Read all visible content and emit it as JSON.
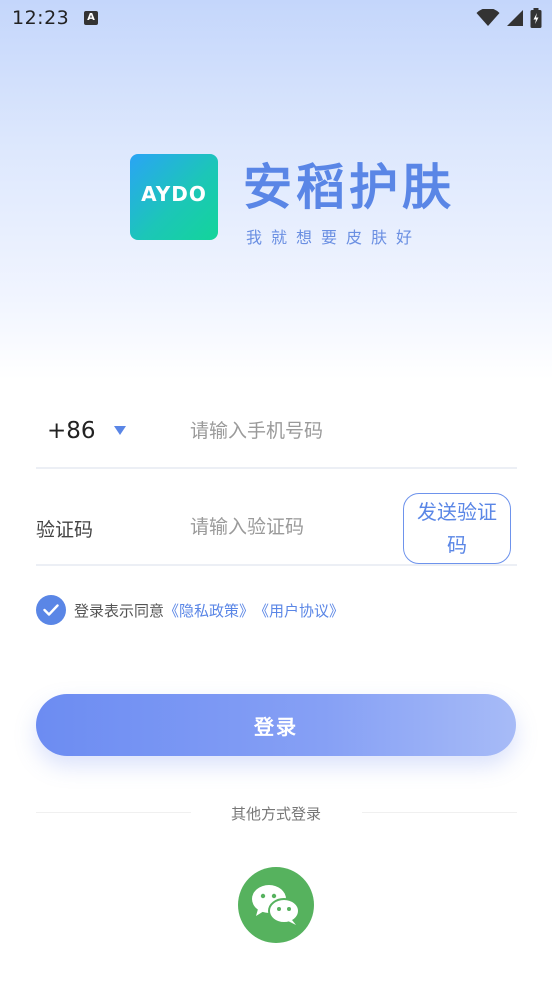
{
  "status_bar": {
    "time": "12:23",
    "notification_icon_label": "A",
    "icons": [
      "wifi-icon",
      "signal-icon",
      "battery-charging-icon"
    ]
  },
  "brand": {
    "logo_text": "AYDO",
    "title": "安稻护肤",
    "slogan": "我就想要皮肤好",
    "logo_colors": [
      "#2aa4f5",
      "#13d59a"
    ]
  },
  "form": {
    "country_code": "+86",
    "phone_placeholder": "请输入手机号码",
    "code_label": "验证码",
    "code_placeholder": "请输入验证码",
    "send_code_label": "发送验证码"
  },
  "agreement": {
    "checked": true,
    "prefix": "登录表示同意",
    "privacy_link": "《隐私政策》",
    "user_link": "《用户协议》"
  },
  "login_button": "登录",
  "other_login": {
    "label": "其他方式登录",
    "methods": [
      "wechat-icon"
    ]
  },
  "colors": {
    "accent": "#5a86e6",
    "wechat": "#56b25e"
  }
}
